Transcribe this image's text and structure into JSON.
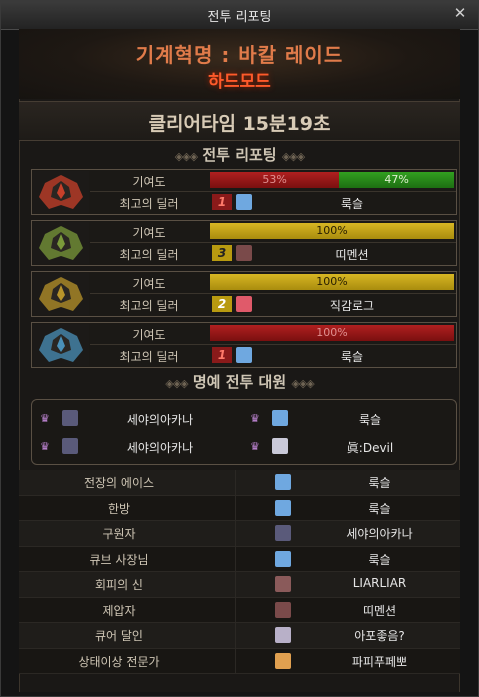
{
  "window": {
    "title": "전투 리포팅",
    "close_glyph": "✕"
  },
  "raid": {
    "name": "기계혁명 : 바칼 레이드",
    "mode": "하드모드",
    "clear_time": "클리어타임  15분19초"
  },
  "sections": {
    "report_title": "전투 리포팅",
    "honor_title": "명예 전투 대원",
    "ornament_left": "◈◈◈",
    "ornament_right": "◈◈◈"
  },
  "labels": {
    "contribution": "기여도",
    "top_dealer": "최고의 딜러"
  },
  "colors": {
    "red": "#b02020",
    "green": "#32a020",
    "gold": "#d7b623"
  },
  "parties": [
    {
      "portrait_icon": "red-dragon-head-icon",
      "portrait_color": "#c8402a",
      "segments": [
        {
          "label": "53%",
          "value": 0.53,
          "color": "red"
        },
        {
          "label": "47%",
          "value": 0.47,
          "color": "green"
        }
      ],
      "rank": "1",
      "rank_color": "r1",
      "avatar_color": "#6fa8e0",
      "dealer": "룩슬"
    },
    {
      "portrait_icon": "green-dragon-head-icon",
      "portrait_color": "#7a9a3a",
      "segments": [
        {
          "label": "100%",
          "value": 1.0,
          "color": "gold"
        }
      ],
      "rank": "3",
      "rank_color": "r3",
      "avatar_color": "#7a4a4a",
      "dealer": "띠멘션"
    },
    {
      "portrait_icon": "gold-dragon-head-icon",
      "portrait_color": "#b8942a",
      "segments": [
        {
          "label": "100%",
          "value": 1.0,
          "color": "gold"
        }
      ],
      "rank": "2",
      "rank_color": "r2",
      "avatar_color": "#e05a6a",
      "dealer": "직감로그"
    },
    {
      "portrait_icon": "blue-dragon-head-icon",
      "portrait_color": "#4a90b8",
      "segments": [
        {
          "label": "100%",
          "value": 1.0,
          "color": "red"
        }
      ],
      "rank": "1",
      "rank_color": "r1",
      "avatar_color": "#6fa8e0",
      "dealer": "룩슬"
    }
  ],
  "honor": [
    {
      "name": "세야의아카나",
      "avatar_color": "#5a5a7a"
    },
    {
      "name": "룩슬",
      "avatar_color": "#6fa8e0"
    },
    {
      "name": "세야의아카나",
      "avatar_color": "#5a5a7a"
    },
    {
      "name": "眞:Devil",
      "avatar_color": "#c9c9d8"
    }
  ],
  "awards": [
    {
      "title": "전장의 에이스",
      "name": "룩슬",
      "avatar_color": "#6fa8e0"
    },
    {
      "title": "한방",
      "name": "룩슬",
      "avatar_color": "#6fa8e0"
    },
    {
      "title": "구원자",
      "name": "세야의아카나",
      "avatar_color": "#5a5a7a"
    },
    {
      "title": "큐브 사장님",
      "name": "룩슬",
      "avatar_color": "#6fa8e0"
    },
    {
      "title": "회피의 신",
      "name": "LIARLIAR",
      "avatar_color": "#8a5a5a"
    },
    {
      "title": "제압자",
      "name": "띠멘션",
      "avatar_color": "#7a4a4a"
    },
    {
      "title": "큐어 달인",
      "name": "아포좋음?",
      "avatar_color": "#b8b0c8"
    },
    {
      "title": "상태이상 전문가",
      "name": "파피푸페뽀",
      "avatar_color": "#e0a050"
    }
  ]
}
